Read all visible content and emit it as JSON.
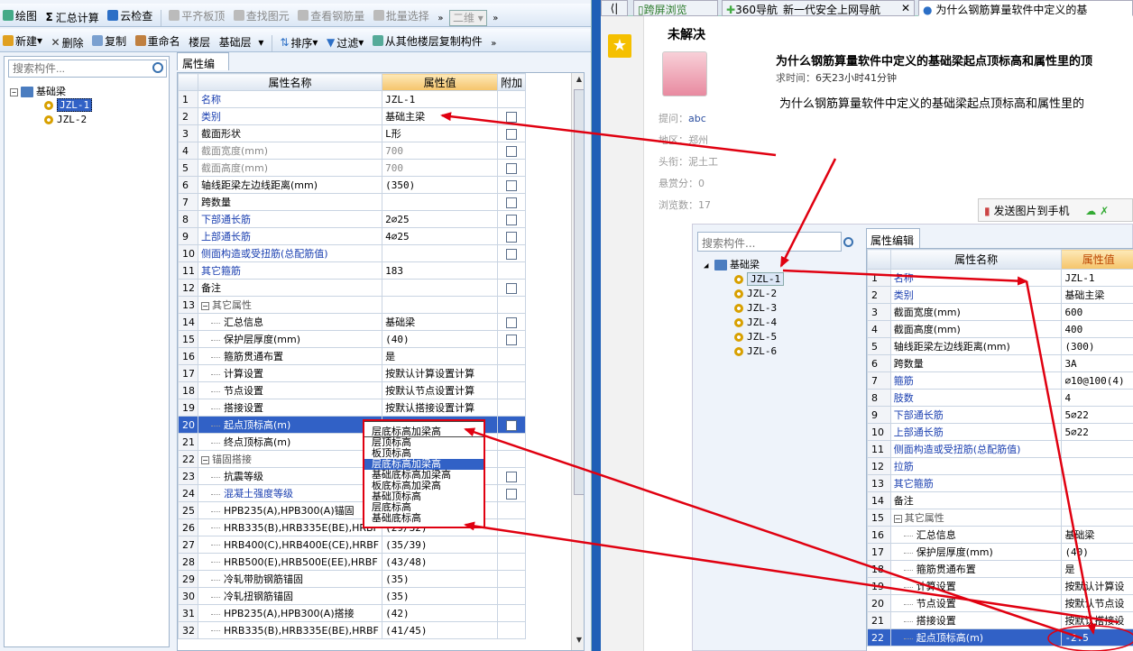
{
  "left_app": {
    "toolbar1": {
      "draw": "绘图",
      "sum": "汇总计算",
      "cloud_check": "云检查",
      "flush_slab": "平齐板顶",
      "find_elem": "查找图元",
      "view_rebar": "查看钢筋量",
      "batch_select": "批量选择",
      "view_mode": "二维"
    },
    "toolbar2": {
      "new": "新建",
      "delete": "删除",
      "copy": "复制",
      "rename": "重命名",
      "floor_label": "楼层",
      "floor_value": "基础层",
      "sort": "排序",
      "filter": "过滤",
      "copy_from_floor": "从其他楼层复制构件"
    },
    "tree": {
      "search_placeholder": "搜索构件...",
      "root": "基础梁",
      "items": [
        "JZL-1",
        "JZL-2"
      ]
    },
    "props": {
      "tab": "属性编辑",
      "headers": [
        "属性名称",
        "属性值",
        "附加"
      ],
      "rows": [
        {
          "n": "1",
          "name": "名称",
          "value": "JZL-1"
        },
        {
          "n": "2",
          "name": "类别",
          "value": "基础主梁"
        },
        {
          "n": "3",
          "name": "截面形状",
          "value": "L形"
        },
        {
          "n": "4",
          "name": "截面宽度(mm)",
          "value": "700"
        },
        {
          "n": "5",
          "name": "截面高度(mm)",
          "value": "700"
        },
        {
          "n": "6",
          "name": "轴线距梁左边线距离(mm)",
          "value": "(350)"
        },
        {
          "n": "7",
          "name": "跨数量",
          "value": ""
        },
        {
          "n": "8",
          "name": "下部通长筋",
          "value": "2⌀25"
        },
        {
          "n": "9",
          "name": "上部通长筋",
          "value": "4⌀25"
        },
        {
          "n": "10",
          "name": "侧面构造或受扭筋(总配筋值)",
          "value": ""
        },
        {
          "n": "11",
          "name": "其它箍筋",
          "value": "183"
        },
        {
          "n": "12",
          "name": "备注",
          "value": ""
        },
        {
          "n": "13",
          "name": "其它属性",
          "value": ""
        },
        {
          "n": "14",
          "name": "汇总信息",
          "value": "基础梁"
        },
        {
          "n": "15",
          "name": "保护层厚度(mm)",
          "value": "(40)"
        },
        {
          "n": "16",
          "name": "箍筋贯通布置",
          "value": "是"
        },
        {
          "n": "17",
          "name": "计算设置",
          "value": "按默认计算设置计算"
        },
        {
          "n": "18",
          "name": "节点设置",
          "value": "按默认节点设置计算"
        },
        {
          "n": "19",
          "name": "搭接设置",
          "value": "按默认搭接设置计算"
        },
        {
          "n": "20",
          "name": "起点顶标高(m)",
          "value": ""
        },
        {
          "n": "21",
          "name": "终点顶标高(m)",
          "value": ""
        },
        {
          "n": "22",
          "name": "锚固搭接",
          "value": ""
        },
        {
          "n": "23",
          "name": "抗震等级",
          "value": ""
        },
        {
          "n": "24",
          "name": "混凝土强度等级",
          "value": ""
        },
        {
          "n": "25",
          "name": "HPB235(A),HPB300(A)锚固",
          "value": ""
        },
        {
          "n": "26",
          "name": "HRB335(B),HRB335E(BE),HRBF",
          "value": "(29/32)"
        },
        {
          "n": "27",
          "name": "HRB400(C),HRB400E(CE),HRBF",
          "value": "(35/39)"
        },
        {
          "n": "28",
          "name": "HRB500(E),HRB500E(EE),HRBF",
          "value": "(43/48)"
        },
        {
          "n": "29",
          "name": "冷轧带肋钢筋锚固",
          "value": "(35)"
        },
        {
          "n": "30",
          "name": "冷轧扭钢筋锚固",
          "value": "(35)"
        },
        {
          "n": "31",
          "name": "HPB235(A),HPB300(A)搭接",
          "value": "(42)"
        },
        {
          "n": "32",
          "name": "HRB335(B),HRB335E(BE),HRBF",
          "value": "(41/45)"
        }
      ],
      "dropdown_input": "层底标高加梁高",
      "dropdown_options": [
        "层顶标高",
        "板顶标高",
        "层底标高加梁高",
        "基础底标高加梁高",
        "板底标高加梁高",
        "基础顶标高",
        "层底标高",
        "基础底标高"
      ],
      "dropdown_selected": 2
    }
  },
  "right_page": {
    "tabs": [
      "跨屏浏览",
      "360导航_新一代安全上网导航",
      "为什么钢筋算量软件中定义的基"
    ],
    "status": "未解决",
    "question_title": "为什么钢筋算量软件中定义的基础梁起点顶标高和属性里的顶",
    "time_label": "求时间：",
    "time_value": "6天23小时41分钟",
    "body": "为什么钢筋算量软件中定义的基础梁起点顶标高和属性里的",
    "asker_label": "提问：",
    "asker": "abc",
    "region_label": "地区：",
    "region": "郑州",
    "title_label": "头衔：",
    "title": "泥土工",
    "reward_label": "悬赏分：",
    "reward": "0",
    "views_label": "浏览数：",
    "views": "17",
    "send_btn": "发送图片到手机",
    "shot": {
      "search_placeholder": "搜索构件...",
      "tab": "属性编辑",
      "root": "基础梁",
      "items": [
        "JZL-1",
        "JZL-2",
        "JZL-3",
        "JZL-4",
        "JZL-5",
        "JZL-6"
      ],
      "headers": [
        "属性名称",
        "属性值"
      ],
      "rows": [
        {
          "n": "1",
          "name": "名称",
          "value": "JZL-1"
        },
        {
          "n": "2",
          "name": "类别",
          "value": "基础主梁"
        },
        {
          "n": "3",
          "name": "截面宽度(mm)",
          "value": "600"
        },
        {
          "n": "4",
          "name": "截面高度(mm)",
          "value": "400"
        },
        {
          "n": "5",
          "name": "轴线距梁左边线距离(mm)",
          "value": "(300)"
        },
        {
          "n": "6",
          "name": "跨数量",
          "value": "3A"
        },
        {
          "n": "7",
          "name": "箍筋",
          "value": "⌀10@100(4)"
        },
        {
          "n": "8",
          "name": "肢数",
          "value": "4"
        },
        {
          "n": "9",
          "name": "下部通长筋",
          "value": "5⌀22"
        },
        {
          "n": "10",
          "name": "上部通长筋",
          "value": "5⌀22"
        },
        {
          "n": "11",
          "name": "侧面构造或受扭筋(总配筋值)",
          "value": ""
        },
        {
          "n": "12",
          "name": "拉筋",
          "value": ""
        },
        {
          "n": "13",
          "name": "其它箍筋",
          "value": ""
        },
        {
          "n": "14",
          "name": "备注",
          "value": ""
        },
        {
          "n": "15",
          "name": "其它属性",
          "value": ""
        },
        {
          "n": "16",
          "name": "汇总信息",
          "value": "基础梁"
        },
        {
          "n": "17",
          "name": "保护层厚度(mm)",
          "value": "(40)"
        },
        {
          "n": "18",
          "name": "箍筋贯通布置",
          "value": "是"
        },
        {
          "n": "19",
          "name": "计算设置",
          "value": "按默认计算设"
        },
        {
          "n": "20",
          "name": "节点设置",
          "value": "按默认节点设"
        },
        {
          "n": "21",
          "name": "搭接设置",
          "value": "按默认搭接设"
        },
        {
          "n": "22",
          "name": "起点顶标高(m)",
          "value": "-2.5"
        }
      ]
    }
  }
}
